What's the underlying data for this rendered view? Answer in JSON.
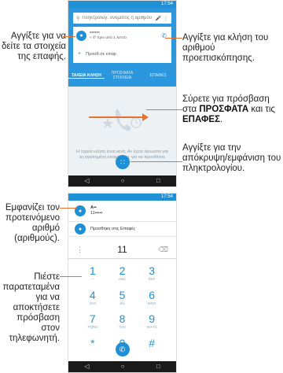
{
  "colors": {
    "accent": "#1f8fd6",
    "leader": "#e8722c"
  },
  "screen1": {
    "status_time": "17:54",
    "search_placeholder": "Πληκτρολόγ. ονόματος ή αριθμού",
    "recent_contact_name": "******",
    "recent_contact_detail": "« ✆ πριν από 1 λεπτό",
    "create_contact": "Προσθ.σε επαφ.",
    "tabs": [
      "ΤΑΧΕΙΑ ΚΛΗΣΗ",
      "ΠΡΟΣΦΑΤΑ ΣΤΟΙΧΕΙΑ",
      "ΕΠΑΦΕΣ"
    ],
    "empty_text": "Η ταχεία κλήση είναι κενή. Αν έχετε άγνωστο για τη αγαπημένη επαφές σας για να προσθέστε"
  },
  "screen2": {
    "status_time": "17:54",
    "contact_name": "A••",
    "contact_number": "11•••••",
    "add_to_contacts": "Προσθήκη στις Επαφές",
    "typed_number": "11",
    "keys": [
      {
        "digit": "1",
        "sub": "―"
      },
      {
        "digit": "2",
        "sub": "ABC"
      },
      {
        "digit": "3",
        "sub": "DEF"
      },
      {
        "digit": "4",
        "sub": "GHI"
      },
      {
        "digit": "5",
        "sub": "JKL"
      },
      {
        "digit": "6",
        "sub": "MNO"
      },
      {
        "digit": "7",
        "sub": "PQRS"
      },
      {
        "digit": "8",
        "sub": "TUV"
      },
      {
        "digit": "9",
        "sub": "WXYZ"
      },
      {
        "digit": "*",
        "sub": ""
      },
      {
        "digit": "0",
        "sub": "+"
      },
      {
        "digit": "#",
        "sub": ""
      }
    ]
  },
  "annotations": {
    "tap_details": "Αγγίξτε για να δείτε τα στοιχεία της επαφής.",
    "tap_call": "Αγγίξτε για κλήση του αριθμού προεπισκόπησης.",
    "swipe_prefix": "Σύρετε για πρόσβαση στα",
    "swipe_recent": "ΠΡΟΣΦΑΤΑ",
    "swipe_and": "και τις",
    "swipe_contacts": "ΕΠΑΦΕΣ",
    "tap_keypad": "Αγγίξτε για την απόκρυψη/εμφάνιση του πληκτρολογίου.",
    "shows_number": "Εμφανίζει τον προτεινόμενο αριθμό (αριθμούς).",
    "press_hold": "Πιέστε παρατεταμένα για να αποκτήσετε πρόσβαση στον τηλεφωνητή."
  }
}
